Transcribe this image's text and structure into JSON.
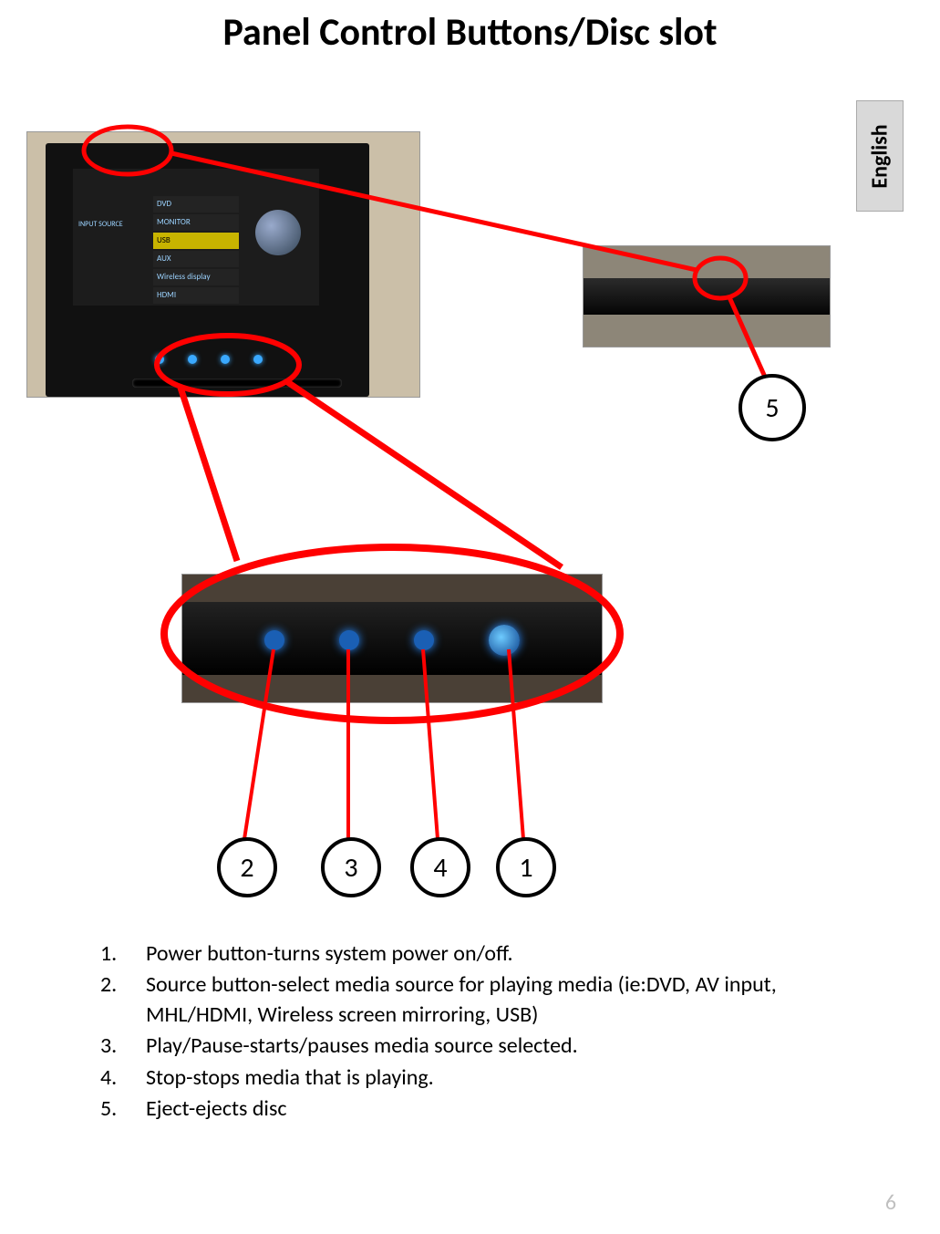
{
  "title": "Panel Control Buttons/Disc slot",
  "language_tab": "English",
  "page_number": "6",
  "screen_menu": {
    "left_label": "INPUT\nSOURCE",
    "items": [
      "DVD",
      "MONITOR",
      "USB",
      "AUX",
      "Wireless display",
      "HDMI"
    ],
    "highlight_index": 2
  },
  "callouts": {
    "c1": "1",
    "c2": "2",
    "c3": "3",
    "c4": "4",
    "c5": "5"
  },
  "list": {
    "i1_n": "1.",
    "i1_t": "Power button-turns system power on/off.",
    "i2_n": "2.",
    "i2_t": "Source button-select media source for playing media (ie:DVD, AV input, MHL/HDMI,  Wireless screen mirroring, USB)",
    "i3_n": "3.",
    "i3_t": "Play/Pause-starts/pauses media source selected.",
    "i4_n": "4.",
    "i4_t": "Stop-stops media that is playing.",
    "i5_n": "5.",
    "i5_t": "Eject-ejects disc"
  }
}
